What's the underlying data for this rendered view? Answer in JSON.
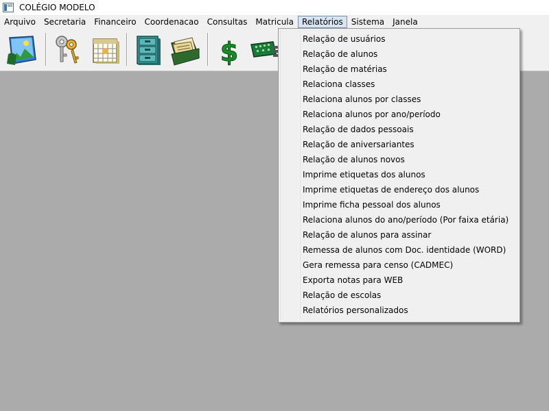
{
  "window": {
    "title": "COLÉGIO MODELO"
  },
  "menubar": {
    "items": [
      "Arquivo",
      "Secretaria",
      "Financeiro",
      "Coordenacao",
      "Consultas",
      "Matricula",
      "Relatórios",
      "Sistema",
      "Janela"
    ],
    "active": "Relatórios"
  },
  "toolbar": {
    "icons": [
      "landscape-photo-icon",
      "keys-icon",
      "calendar-icon",
      "filing-cabinet-icon",
      "documents-folder-icon",
      "dollar-icon",
      "circuit-board-icon"
    ]
  },
  "relatorios_menu": {
    "items": [
      "Relação de usuários",
      "Relação de alunos",
      "Relação de matérias",
      "Relaciona classes",
      "Relaciona alunos por classes",
      "Relaciona alunos por ano/período",
      "Relação de dados pessoais",
      "Relação de aniversariantes",
      "Relação de alunos novos",
      "Imprime etiquetas dos alunos",
      "Imprime etiquetas de endereço dos alunos",
      "Imprime ficha pessoal dos alunos",
      "Relaciona alunos do ano/período (Por faixa etária)",
      "Relação de alunos para assinar",
      "Remessa de alunos com Doc. identidade (WORD)",
      "Gera remessa para censo (CADMEC)",
      "Exporta notas para WEB",
      "Relação de escolas",
      "Relatórios personalizados"
    ]
  },
  "colors": {
    "workspace": "#ababab",
    "menu_bg": "#f0f0f0",
    "menu_highlight": "#d8e4f2"
  }
}
